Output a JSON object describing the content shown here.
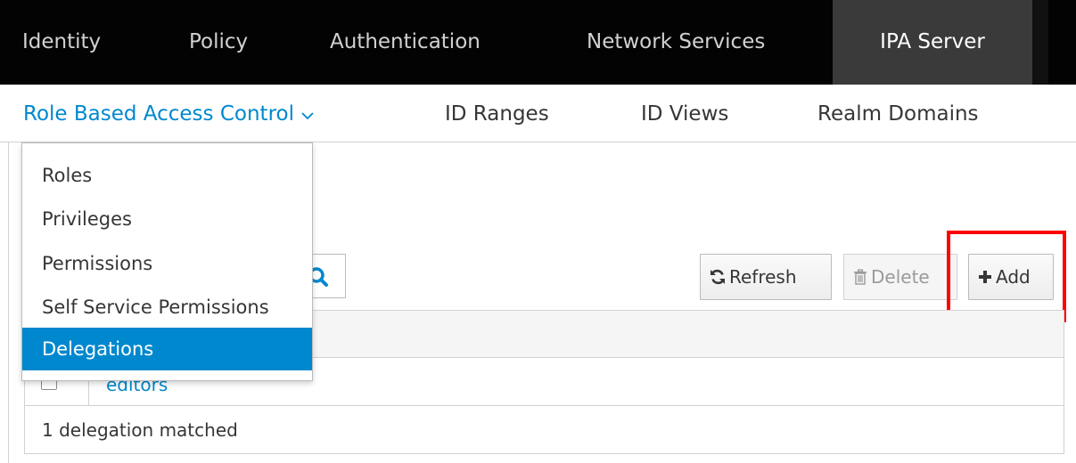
{
  "top_nav": {
    "items": [
      {
        "label": "Identity"
      },
      {
        "label": "Policy"
      },
      {
        "label": "Authentication"
      },
      {
        "label": "Network Services"
      },
      {
        "label": "IPA Server"
      }
    ],
    "active": "IPA Server"
  },
  "sub_nav": {
    "items": [
      {
        "label": "Role Based Access Control"
      },
      {
        "label": "ID Ranges"
      },
      {
        "label": "ID Views"
      },
      {
        "label": "Realm Domains"
      }
    ],
    "active": "Role Based Access Control",
    "caret_icon": "chevron-down-icon"
  },
  "dropdown": {
    "items": [
      {
        "label": "Roles"
      },
      {
        "label": "Privileges"
      },
      {
        "label": "Permissions"
      },
      {
        "label": "Self Service Permissions"
      },
      {
        "label": "Delegations"
      }
    ],
    "selected": "Delegations"
  },
  "toolbar": {
    "refresh_label": "Refresh",
    "delete_label": "Delete",
    "add_label": "Add",
    "refresh_icon": "refresh-icon",
    "delete_icon": "trash-icon",
    "add_icon": "plus-icon",
    "search_icon": "search-icon"
  },
  "table": {
    "rows": [
      {
        "name": "editors",
        "checked": false
      }
    ],
    "footer": "1 delegation matched"
  },
  "colors": {
    "accent": "#0088ce",
    "topnav_bg": "#030303",
    "topnav_active_bg": "#3a3a3a",
    "highlight": "#ff0000"
  }
}
